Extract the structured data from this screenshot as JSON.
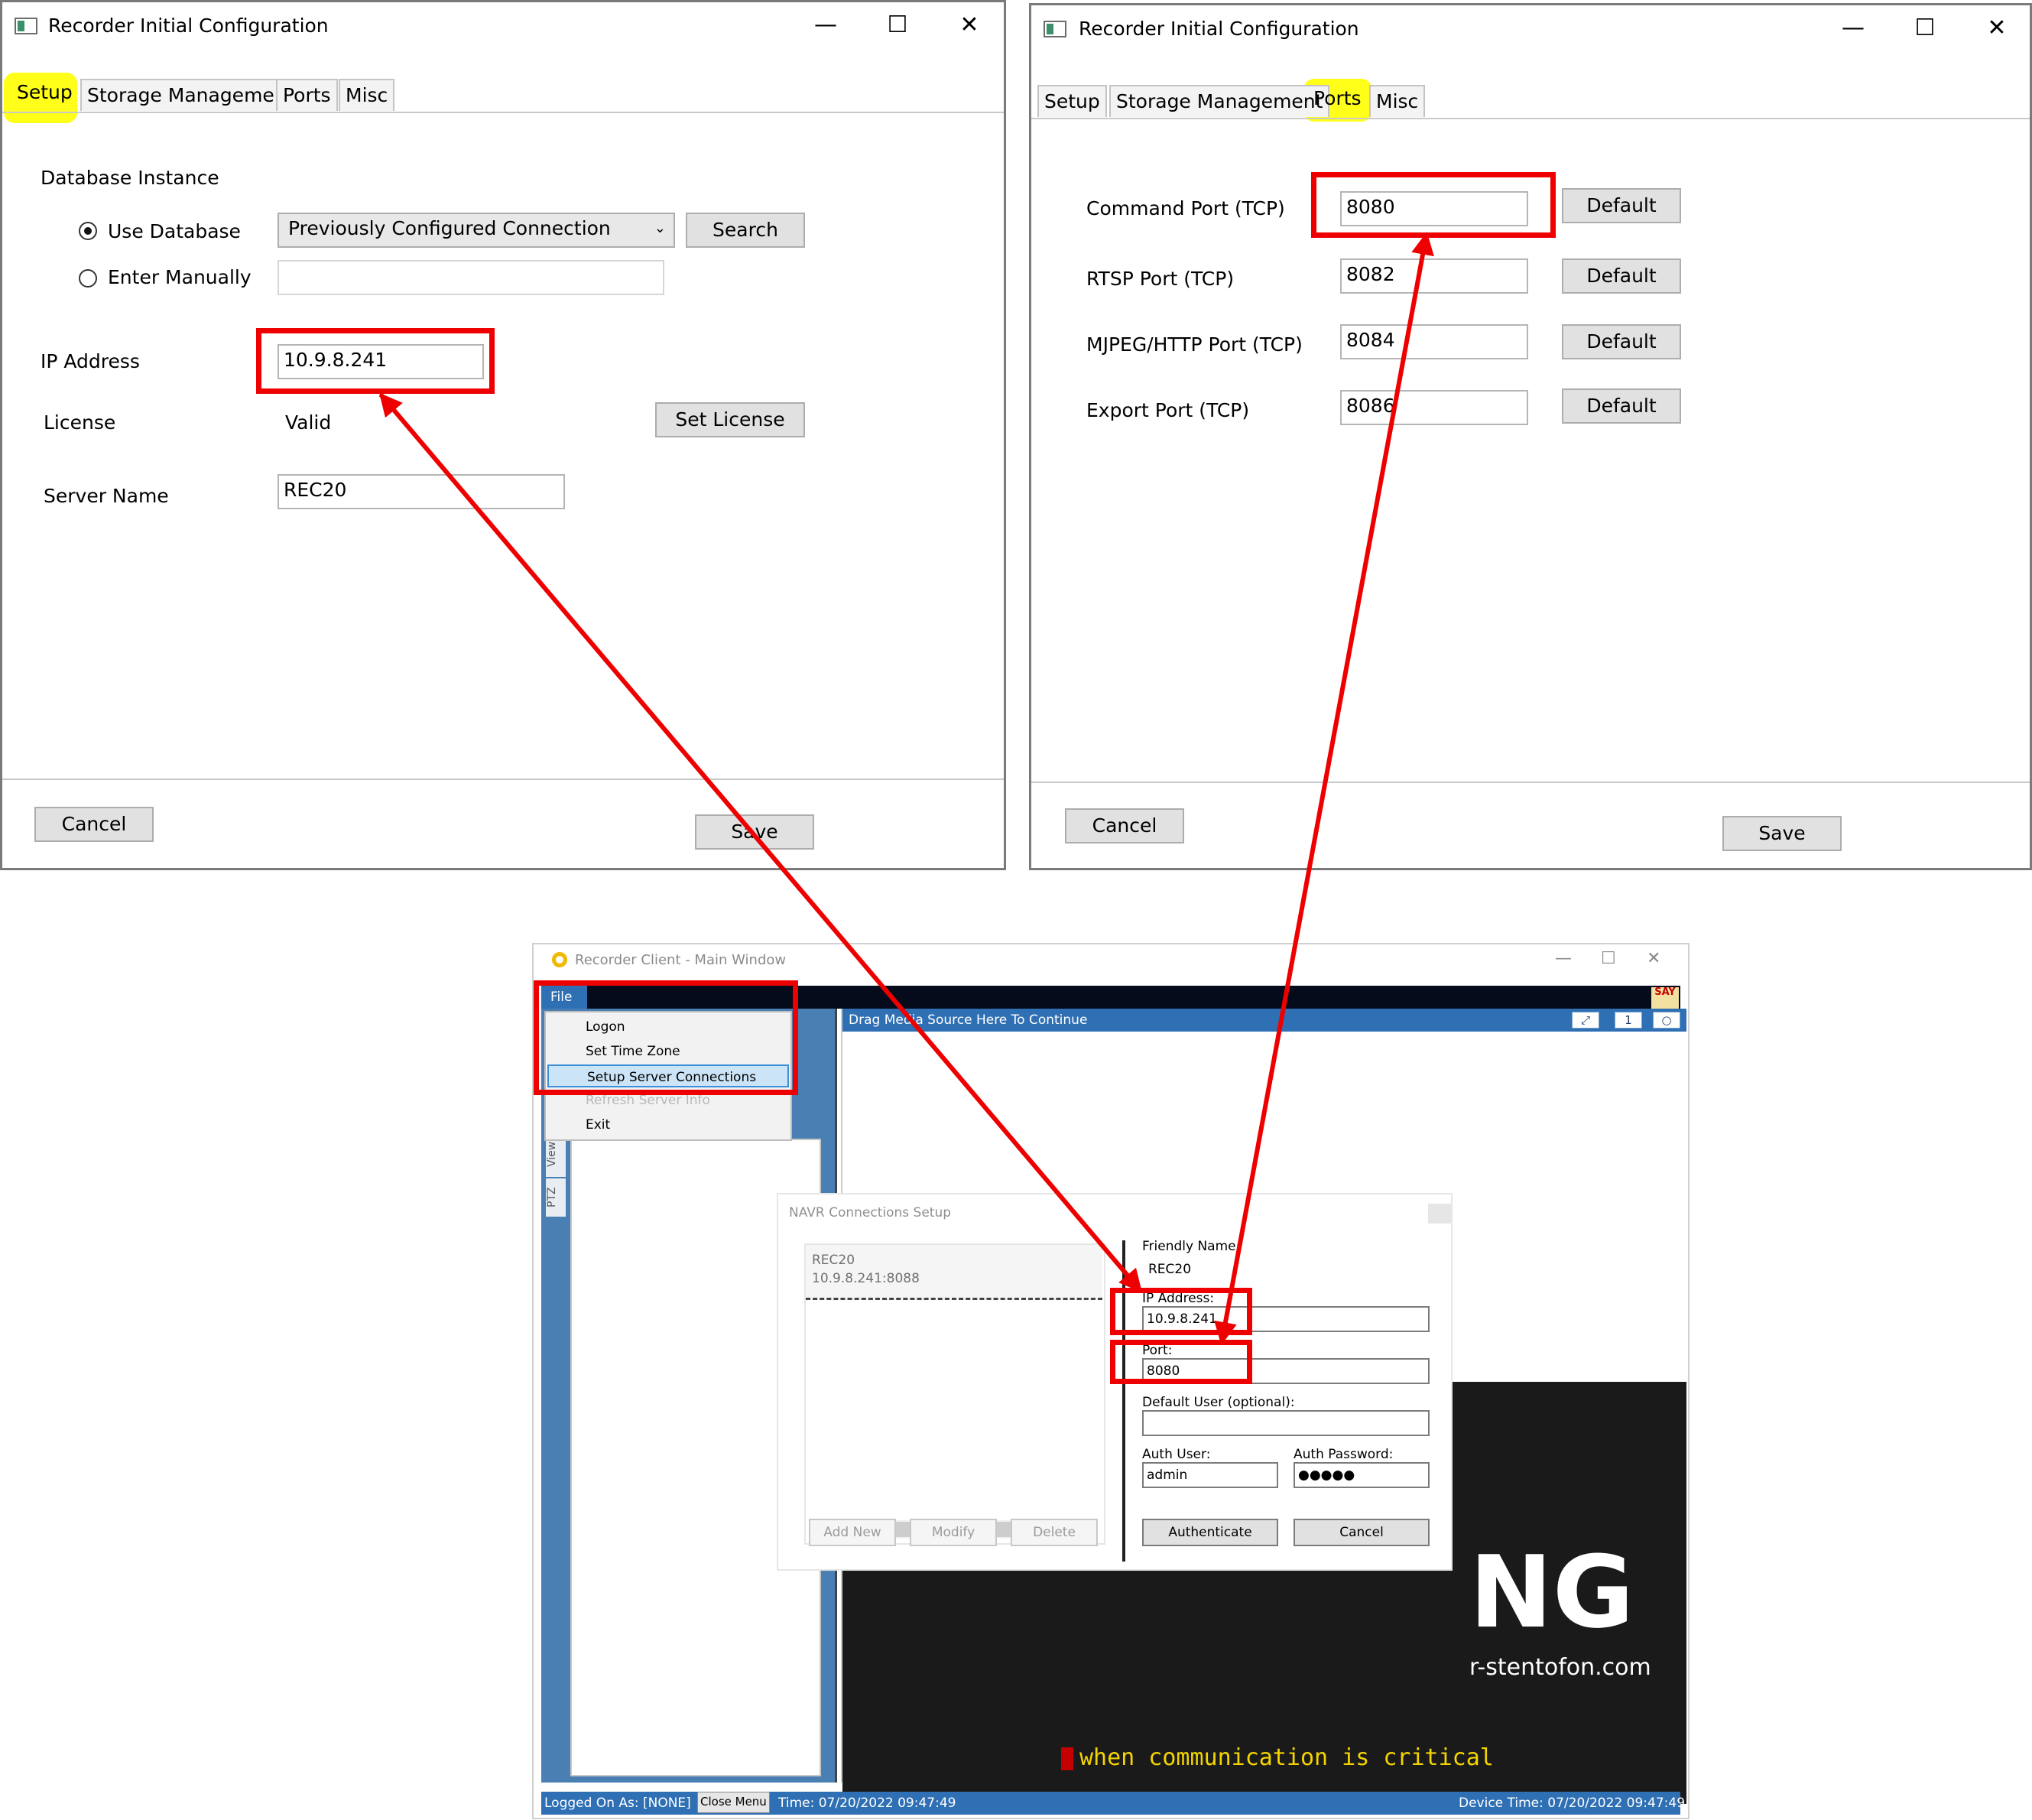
{
  "setup_window": {
    "title": "Recorder Initial Configuration",
    "controls": {
      "minimize": "—",
      "maximize": "☐",
      "close": "✕"
    },
    "tabs": [
      "Setup",
      "Storage Management",
      "Ports",
      "Misc"
    ],
    "database_instance_label": "Database Instance",
    "use_database_label": "Use Database",
    "enter_manually_label": "Enter Manually",
    "connection_select_value": "Previously Configured Connection",
    "search_button": "Search",
    "manual_input_value": "",
    "ip_address_label": "IP Address",
    "ip_address_value": "10.9.8.241",
    "license_label": "License",
    "license_value": "Valid",
    "set_license_button": "Set License",
    "server_name_label": "Server Name",
    "server_name_value": "REC20",
    "cancel_button": "Cancel",
    "save_button": "Save"
  },
  "ports_window": {
    "title": "Recorder Initial Configuration",
    "controls": {
      "minimize": "—",
      "maximize": "☐",
      "close": "✕"
    },
    "tabs": [
      "Setup",
      "Storage Management",
      "Ports",
      "Misc"
    ],
    "ports": [
      {
        "label": "Command Port (TCP)",
        "value": "8080",
        "button": "Default"
      },
      {
        "label": "RTSP Port (TCP)",
        "value": "8082",
        "button": "Default"
      },
      {
        "label": "MJPEG/HTTP Port (TCP)",
        "value": "8084",
        "button": "Default"
      },
      {
        "label": "Export Port (TCP)",
        "value": "8086",
        "button": "Default"
      }
    ],
    "cancel_button": "Cancel",
    "save_button": "Save"
  },
  "client_window": {
    "title": "Recorder Client - Main Window",
    "controls": {
      "minimize": "—",
      "maximize": "☐",
      "close": "✕"
    },
    "file_menu": "File",
    "logo_text": "SAY",
    "menu_items": [
      "Logon",
      "Set Time Zone",
      "Setup Server Connections",
      "Refresh Server Info",
      "Exit"
    ],
    "side_tabs": [
      "View",
      "PTZ"
    ],
    "drag_bar_text": "Drag Media Source Here To Continue",
    "drag_buttons": [
      "⤢",
      "1",
      "○"
    ],
    "video_big_text": "NG",
    "video_url": "r-stentofon.com",
    "video_tagline": "when communication is critical",
    "status": {
      "logged_on": "Logged On As: [NONE]",
      "close_menu": "Close Menu",
      "time": "Time: 07/20/2022 09:47:49",
      "device_time": "Device Time: 07/20/2022 09:47:49"
    }
  },
  "navr_dialog": {
    "title": "NAVR Connections Setup",
    "list_item_name": "REC20",
    "list_item_address": "10.9.8.241:8088",
    "add_new_button": "Add New",
    "modify_button": "Modify",
    "delete_button": "Delete",
    "friendly_name_label": "Friendly Name:",
    "friendly_name_value": "REC20",
    "ip_address_label": "IP Address:",
    "ip_address_value": "10.9.8.241",
    "port_label": "Port:",
    "port_value": "8080",
    "default_user_label": "Default User (optional):",
    "default_user_value": "",
    "auth_user_label": "Auth User:",
    "auth_user_value": "admin",
    "auth_password_label": "Auth Password:",
    "auth_password_value": "●●●●●",
    "authenticate_button": "Authenticate",
    "cancel_button": "Cancel"
  },
  "colors": {
    "annotation_red": "#ee0000",
    "highlight_yellow": "#ffff1a",
    "client_blue": "#2f6fb3"
  }
}
